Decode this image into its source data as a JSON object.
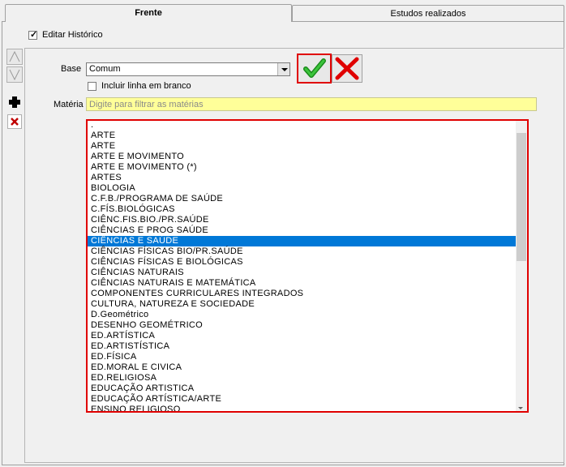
{
  "tabs": [
    {
      "label": "Frente"
    },
    {
      "label": "Estudos realizados"
    }
  ],
  "editar_historico": {
    "label": "Editar Histórico",
    "checked": true
  },
  "base": {
    "label": "Base",
    "value": "Comum"
  },
  "incluir_linha": {
    "label": "Incluir linha em branco",
    "checked": false
  },
  "materia": {
    "label": "Matéria",
    "placeholder": "Digite para filtrar as matérias"
  },
  "colors": {
    "accent_border": "#e00000",
    "selection": "#0078d7",
    "filter_bg": "#ffff99",
    "ok_icon": "#22a022",
    "cancel_icon": "#e00000"
  },
  "icons": {
    "ok": "checkmark-icon",
    "cancel": "x-icon",
    "add": "plus-icon",
    "remove": "delete-icon",
    "up": "arrow-up-icon",
    "down": "arrow-down-icon"
  },
  "materias": [
    ".",
    "ARTE",
    "ARTE",
    "ARTE E MOVIMENTO",
    "ARTE E MOVIMENTO (*)",
    "ARTES",
    "BIOLOGIA",
    "C.F.B./PROGRAMA DE SAÚDE",
    "C.FÍS.BIOLÓGICAS",
    "CIÊNC.FIS.BIO./PR.SAÚDE",
    "CIÊNCIAS E PROG SAÚDE",
    "CIÊNCIAS E SAÚDE",
    "CIÊNCIAS FÍSICAS BIO/PR.SAÚDE",
    "CIÊNCIAS FÍSICAS E BIOLÓGICAS",
    "CIÊNCIAS NATURAIS",
    "CIÊNCIAS NATURAIS E MATEMÁTICA",
    "COMPONENTES CURRICULARES INTEGRADOS",
    "CULTURA, NATUREZA E SOCIEDADE",
    "D.Geométrico",
    "DESENHO GEOMÉTRICO",
    "ED.ARTÍSTICA",
    "ED.ARTISTÍSTICA",
    "ED.FÍSICA",
    "ED.MORAL E CIVICA",
    "ED.RELIGIOSA",
    "EDUCAÇÃO ARTISTICA",
    "EDUCAÇÃO ARTÍSTICA/ARTE",
    "ENSINO RELIGIOSO"
  ],
  "selected_index": 11
}
